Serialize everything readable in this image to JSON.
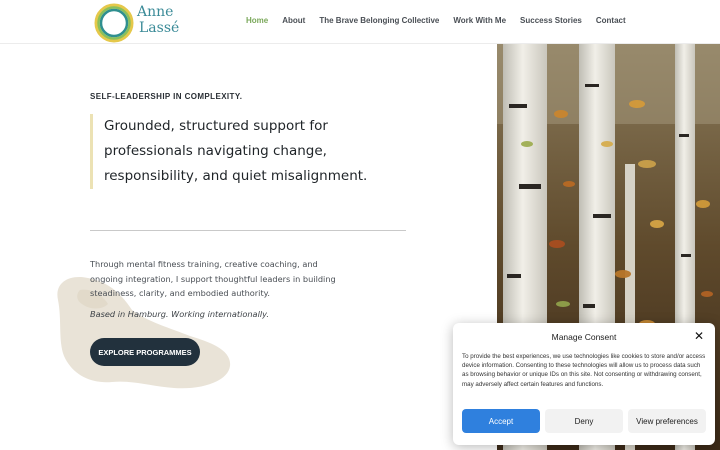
{
  "site": {
    "logo": {
      "line1": "Anne",
      "line2": "Lassé",
      "icon": "circle-rings-logo"
    },
    "nav": [
      {
        "label": "Home",
        "active": true
      },
      {
        "label": "About",
        "active": false
      },
      {
        "label": "The Brave Belonging Collective",
        "active": false
      },
      {
        "label": "Work With Me",
        "active": false
      },
      {
        "label": "Success Stories",
        "active": false
      },
      {
        "label": "Contact",
        "active": false
      }
    ]
  },
  "hero": {
    "eyebrow": "SELF-LEADERSHIP IN COMPLEXITY.",
    "quote": "Grounded, structured support for professionals navigating change, responsibility, and quiet misalignment.",
    "body": "Through mental fitness training, creative coaching, and ongoing integration, I support thoughtful leaders in building steadiness, clarity, and embodied authority.",
    "location": "Based in Hamburg. Working internationally.",
    "cta": "Explore Programmes",
    "image": "birch-trees-autumn-photo"
  },
  "consent": {
    "title": "Manage Consent",
    "close_icon": "close-icon",
    "text": "To provide the best experiences, we use technologies like cookies to store and/or access device information. Consenting to these technologies will allow us to process data such as browsing behavior or unique IDs on this site. Not consenting or withdrawing consent, may adversely affect certain features and functions.",
    "accept": "Accept",
    "deny": "Deny",
    "preferences": "View preferences"
  },
  "colors": {
    "nav_active": "#7aa85a",
    "logo_text": "#3b8b98",
    "cta_bg": "#22313d",
    "accept_bg": "#2f80de",
    "quote_border": "#ece2b4"
  }
}
